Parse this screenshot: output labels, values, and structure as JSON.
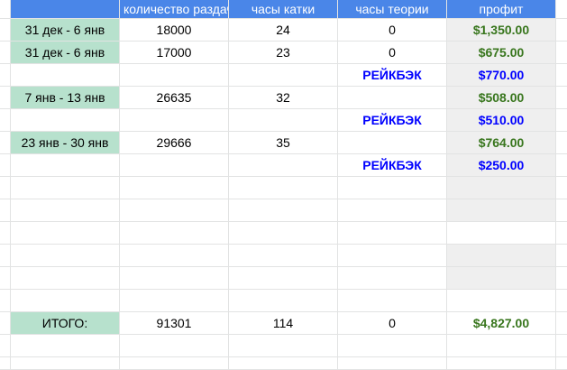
{
  "header": {
    "col_hands": "количество раздач",
    "col_play_hours": "часы катки",
    "col_theory_hours": "часы теории",
    "col_profit": "профит"
  },
  "rows": [
    {
      "period": "31 дек - 6 янв",
      "hands": "18000",
      "play_hours": "24",
      "theory_hours": "0",
      "profit": "$1,350.00"
    },
    {
      "period": "31 дек - 6 янв",
      "hands": "17000",
      "play_hours": "23",
      "theory_hours": "0",
      "profit": "$675.00"
    },
    {
      "period": "",
      "hands": "",
      "play_hours": "",
      "theory_hours": "РЕЙКБЭК",
      "profit": "$770.00"
    },
    {
      "period": "7 янв - 13 янв",
      "hands": "26635",
      "play_hours": "32",
      "theory_hours": "",
      "profit": "$508.00"
    },
    {
      "period": "",
      "hands": "",
      "play_hours": "",
      "theory_hours": "РЕЙКБЭК",
      "profit": "$510.00"
    },
    {
      "period": "23 янв - 30 янв",
      "hands": "29666",
      "play_hours": "35",
      "theory_hours": "",
      "profit": "$764.00"
    },
    {
      "period": "",
      "hands": "",
      "play_hours": "",
      "theory_hours": "РЕЙКБЭК",
      "profit": "$250.00"
    }
  ],
  "total": {
    "label": "ИТОГО:",
    "hands": "91301",
    "play_hours": "114",
    "theory_hours": "0",
    "profit": "$4,827.00"
  },
  "colors": {
    "header_bg": "#4a86e8",
    "period_bg": "#b7e1cd",
    "profit_bg": "#efefef",
    "profit_green": "#38761d",
    "rakeback_blue": "#0000ff"
  }
}
